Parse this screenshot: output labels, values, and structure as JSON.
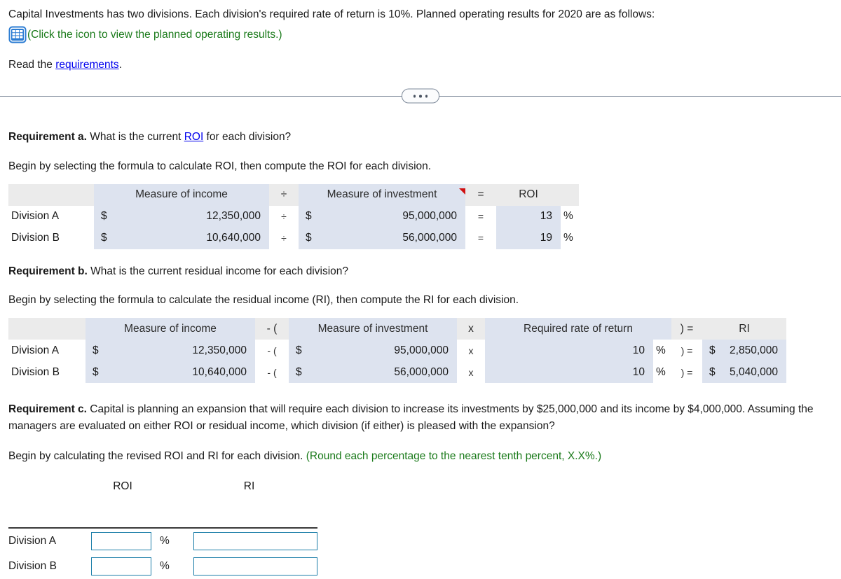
{
  "intro": {
    "paragraph": "Capital Investments has two divisions. Each division's required rate of return is 10%. Planned operating results for 2020 are as follows:",
    "icon_name": "table-grid-icon",
    "icon_note": "(Click the icon to view the planned operating results.)",
    "read_prefix": "Read the ",
    "read_link": "requirements",
    "read_suffix": "."
  },
  "divider": {
    "ellipsis_label": "…"
  },
  "requirement_a": {
    "label": "Requirement a.",
    "question_before_link": " What is the current ",
    "question_link": "ROI",
    "question_after_link": " for each division?",
    "instruction": "Begin by selecting the formula to calculate ROI, then compute the ROI for each division.",
    "table": {
      "headers": {
        "corner": "",
        "income": "Measure of income",
        "op1": "÷",
        "investment": "Measure of investment",
        "op2": "=",
        "result": "ROI"
      },
      "rows": [
        {
          "label": "Division A",
          "income_currency": "$",
          "income": "12,350,000",
          "op1": "÷",
          "investment_currency": "$",
          "investment": "95,000,000",
          "op2": "=",
          "result": "13",
          "result_unit": "%"
        },
        {
          "label": "Division B",
          "income_currency": "$",
          "income": "10,640,000",
          "op1": "÷",
          "investment_currency": "$",
          "investment": "56,000,000",
          "op2": "=",
          "result": "19",
          "result_unit": "%"
        }
      ]
    }
  },
  "requirement_b": {
    "label": "Requirement b.",
    "question": " What is the current residual income for each division?",
    "instruction": "Begin by selecting the formula to calculate the residual income (RI), then compute the RI for each division.",
    "table": {
      "headers": {
        "corner": "",
        "income": "Measure of income",
        "op1": "- (",
        "investment": "Measure of investment",
        "op2": "x",
        "rate": "Required rate of return",
        "op3": ") =",
        "result": "RI"
      },
      "rows": [
        {
          "label": "Division A",
          "income_currency": "$",
          "income": "12,350,000",
          "op1": "- (",
          "investment_currency": "$",
          "investment": "95,000,000",
          "op2": "x",
          "rate": "10",
          "rate_unit": "%",
          "op3": ") =",
          "result_currency": "$",
          "result": "2,850,000"
        },
        {
          "label": "Division B",
          "income_currency": "$",
          "income": "10,640,000",
          "op1": "- (",
          "investment_currency": "$",
          "investment": "56,000,000",
          "op2": "x",
          "rate": "10",
          "rate_unit": "%",
          "op3": ") =",
          "result_currency": "$",
          "result": "5,040,000"
        }
      ]
    }
  },
  "requirement_c": {
    "label": "Requirement c.",
    "question": " Capital is planning an expansion that will require each division to increase its investments by $25,000,000 and its income by $4,000,000. Assuming the managers are evaluated on either ROI or residual income, which division (if either) is pleased with the expansion?",
    "instruction_plain": "Begin by calculating the revised ROI and RI for each division. ",
    "instruction_green": "(Round each percentage to the nearest tenth percent, X.X%.)",
    "table": {
      "headers": {
        "corner": "",
        "roi": "ROI",
        "ri": "RI"
      },
      "rows": [
        {
          "label": "Division A",
          "roi_value": "",
          "roi_placeholder": "",
          "pct": "%",
          "ri_value": "",
          "ri_placeholder": ""
        },
        {
          "label": "Division B",
          "roi_value": "",
          "roi_placeholder": "",
          "pct": "%",
          "ri_value": "",
          "ri_placeholder": ""
        }
      ]
    }
  },
  "colors": {
    "link": "#0000ee",
    "green_note": "#1a7a1a",
    "header_gray": "#ebebeb",
    "cell_blue": "#dde3ef",
    "input_border": "#1a7da8",
    "comment_marker": "#d01010",
    "icon_blue": "#2b7cd3"
  }
}
